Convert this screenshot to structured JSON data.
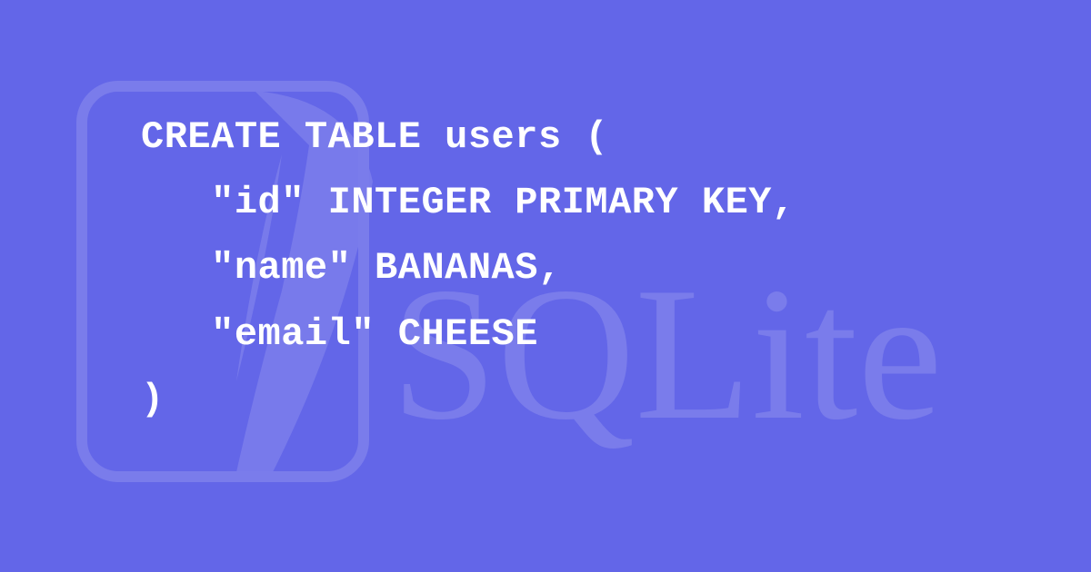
{
  "code": {
    "line1": "CREATE TABLE users (",
    "line2": "   \"id\" INTEGER PRIMARY KEY,",
    "line3": "   \"name\" BANANAS,",
    "line4": "   \"email\" CHEESE",
    "line5": ")"
  },
  "watermark": {
    "text": "SQLite"
  },
  "colors": {
    "background": "#6366e8",
    "text": "#ffffff",
    "watermark": "#7a7ceb"
  }
}
